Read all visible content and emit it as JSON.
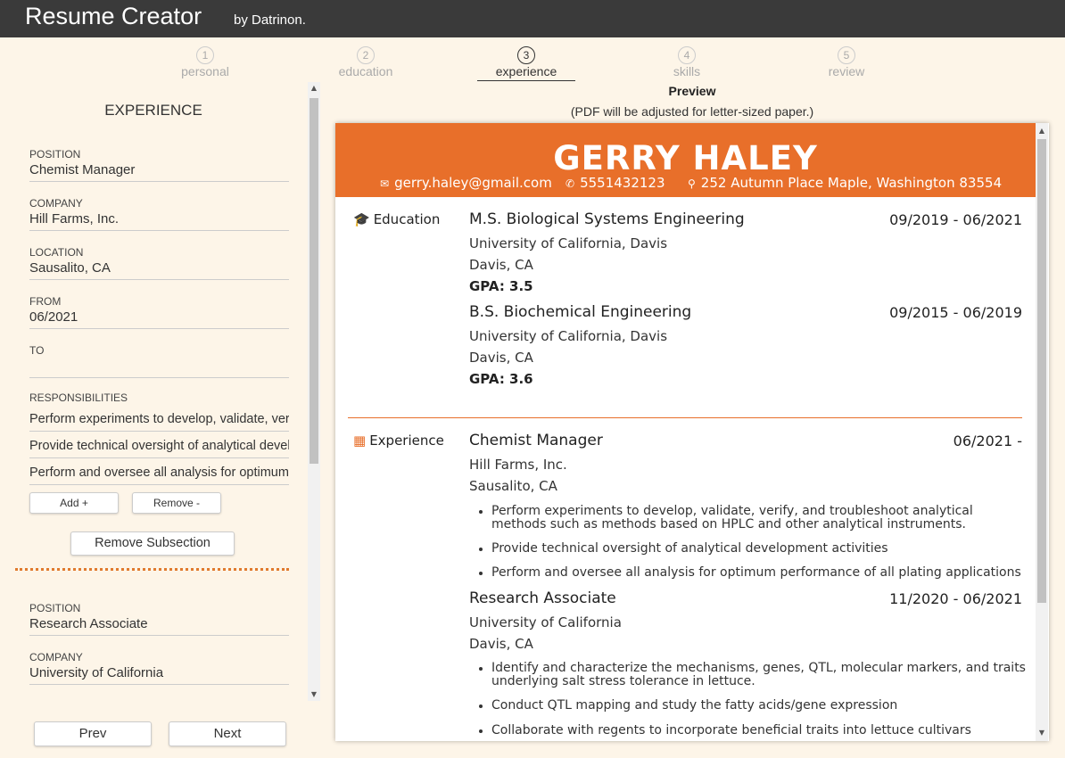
{
  "app": {
    "title": "Resume Creator",
    "by": "by Datrinon."
  },
  "steps": [
    {
      "num": "1",
      "label": "personal"
    },
    {
      "num": "2",
      "label": "education"
    },
    {
      "num": "3",
      "label": "experience"
    },
    {
      "num": "4",
      "label": "skills"
    },
    {
      "num": "5",
      "label": "review"
    }
  ],
  "form": {
    "section_title": "EXPERIENCE",
    "entry1": {
      "position_label": "POSITION",
      "position": "Chemist Manager",
      "company_label": "COMPANY",
      "company": "Hill Farms, Inc.",
      "location_label": "LOCATION",
      "location": "Sausalito, CA",
      "from_label": "FROM",
      "from": "06/2021",
      "to_label": "TO",
      "to": "",
      "responsibilities_label": "RESPONSIBILITIES",
      "responsibilities": [
        "Perform experiments to develop, validate, verify, and troubleshoot analytical methods",
        "Provide technical oversight of analytical development activities",
        "Perform and oversee all analysis for optimum performance of all plating applications"
      ],
      "add_label": "Add +",
      "remove_label": "Remove -",
      "remove_subsection_label": "Remove Subsection"
    },
    "entry2": {
      "position_label": "POSITION",
      "position": "Research Associate",
      "company_label": "COMPANY",
      "company": "University of California"
    }
  },
  "nav": {
    "prev": "Prev",
    "next": "Next"
  },
  "preview": {
    "title": "Preview",
    "note": "(PDF will be adjusted for letter-sized paper.)"
  },
  "resume": {
    "name": "GERRY HALEY",
    "email": "gerry.haley@gmail.com",
    "phone": "5551432123",
    "address": "252 Autumn Place Maple, Washington 83554",
    "education_heading": "Education",
    "education": [
      {
        "degree": "M.S. Biological Systems Engineering",
        "dates": "09/2019 - 06/2021",
        "school": "University of California, Davis",
        "location": "Davis, CA",
        "gpa": "GPA: 3.5"
      },
      {
        "degree": "B.S. Biochemical Engineering",
        "dates": "09/2015 - 06/2019",
        "school": "University of California, Davis",
        "location": "Davis, CA",
        "gpa": "GPA: 3.6"
      }
    ],
    "experience_heading": "Experience",
    "experience": [
      {
        "position": "Chemist Manager",
        "dates": "06/2021 -",
        "company": "Hill Farms, Inc.",
        "location": "Sausalito, CA",
        "bullets": [
          "Perform experiments to develop, validate, verify, and troubleshoot analytical methods such as methods based on HPLC and other analytical instruments.",
          "Provide technical oversight of analytical development activities",
          "Perform and oversee all analysis for optimum performance of all plating applications"
        ]
      },
      {
        "position": "Research Associate",
        "dates": "11/2020 - 06/2021",
        "company": "University of California",
        "location": "Davis, CA",
        "bullets": [
          "Identify and characterize the mechanisms, genes, QTL, molecular markers, and traits underlying salt stress tolerance in lettuce.",
          "Conduct QTL mapping and study the fatty acids/gene expression",
          "Collaborate with regents to incorporate beneficial traits into lettuce cultivars"
        ]
      }
    ]
  },
  "icons": {
    "email": "envelope-icon",
    "phone": "phone-icon",
    "address": "map-marker-icon",
    "education": "graduation-cap-icon",
    "experience": "building-icon"
  },
  "colors": {
    "accent": "#e86f2a",
    "topbar": "#3a3a3a",
    "background": "#fdf5e8"
  }
}
